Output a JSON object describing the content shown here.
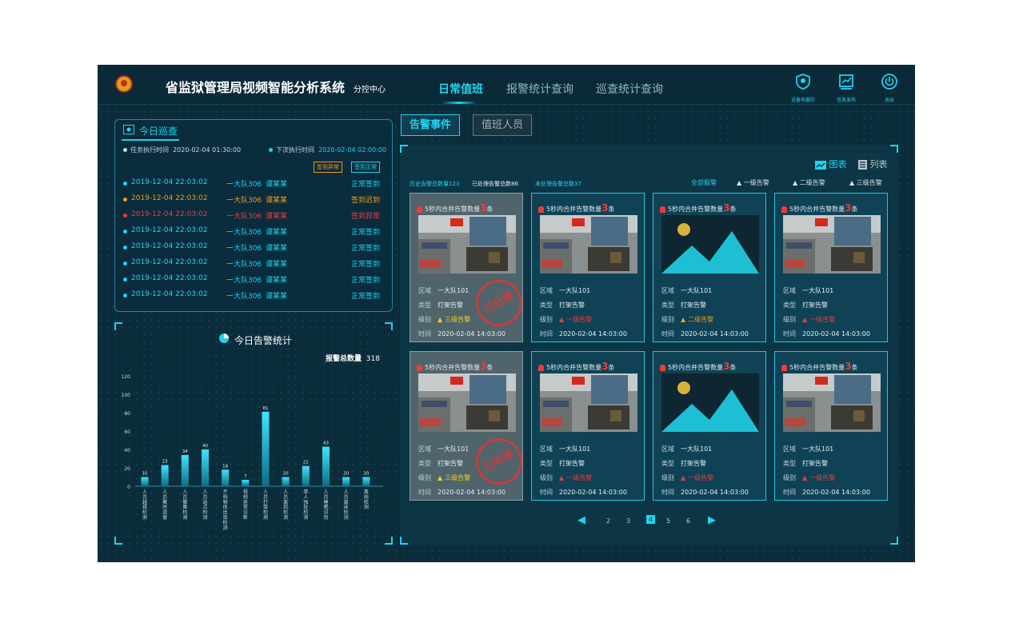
{
  "header": {
    "title": "省监狱管理局视频智能分析系统",
    "subtitle": "分控中心",
    "nav": [
      "日常值班",
      "报警统计查询",
      "巡查统计查询"
    ],
    "active_nav": "日常值班",
    "actions": [
      {
        "label": "设备布撤防",
        "icon": "shield-icon"
      },
      {
        "label": "信息发布",
        "icon": "publish-icon"
      },
      {
        "label": "退出",
        "icon": "power-icon"
      }
    ]
  },
  "patrol": {
    "title": "今日巡查",
    "task_time_label": "任务执行时间",
    "task_time": "2020-02-04 01:30:00",
    "next_time_label": "下次执行时间",
    "next_time": "2020-02-04 02:00:00",
    "btn_abnormal": "签到异常",
    "btn_normal": "签到正常",
    "rows": [
      {
        "time": "2019-12-04 22:03:02",
        "team": "一大队306",
        "name": "谭某某",
        "status": "正常签到",
        "color": "#1ed6f2"
      },
      {
        "time": "2019-12-04 22:03:02",
        "team": "一大队306",
        "name": "谭某某",
        "status": "签到迟到",
        "color": "#f29b1d"
      },
      {
        "time": "2019-12-04 22:03:02",
        "team": "一大队306",
        "name": "谭某某",
        "status": "签到异常",
        "color": "#f03b3b"
      },
      {
        "time": "2019-12-04 22:03:02",
        "team": "一大队306",
        "name": "谭某某",
        "status": "正常签到",
        "color": "#1ed6f2"
      },
      {
        "time": "2019-12-04 22:03:02",
        "team": "一大队306",
        "name": "谭某某",
        "status": "正常签到",
        "color": "#1ed6f2"
      },
      {
        "time": "2019-12-04 22:03:02",
        "team": "一大队306",
        "name": "谭某某",
        "status": "正常签到",
        "color": "#1ed6f2"
      },
      {
        "time": "2019-12-04 22:03:02",
        "team": "一大队306",
        "name": "谭某某",
        "status": "正常签到",
        "color": "#1ed6f2"
      },
      {
        "time": "2019-12-04 22:03:02",
        "team": "一大队306",
        "name": "谭某某",
        "status": "正常签到",
        "color": "#1ed6f2"
      }
    ]
  },
  "alarm_stats": {
    "title": "今日告警统计",
    "total_label": "报警总数量",
    "total": "318"
  },
  "chart_data": {
    "type": "bar",
    "title": "今日告警统计",
    "ylim": [
      0,
      120
    ],
    "yticks": [
      0,
      20,
      40,
      60,
      80,
      100,
      120
    ],
    "categories": [
      "人员越线检测",
      "人员聚时逗留",
      "人员聚集检测",
      "人员返点检测",
      "不明物体出现检测",
      "视频异常诊断",
      "人员打架检测",
      "人员离岗检测",
      "单人独处检测",
      "人员睡眠识别",
      "人员离床检测",
      "离岗检测"
    ],
    "values": [
      10,
      23,
      34,
      40,
      18,
      7,
      81,
      10,
      22,
      43,
      10,
      10
    ],
    "data_labels": [
      "10",
      "23",
      "34",
      "40",
      "18",
      "7",
      "81",
      "20",
      "22",
      "43",
      "20",
      "20"
    ]
  },
  "events": {
    "tab_active": "告警事件",
    "tab_inactive": "值班人员",
    "view_chart": "图表",
    "view_list": "列表",
    "history_label": "历史告警总数量",
    "history_count": "123",
    "processed_label": "已处理告警总数",
    "processed_count": "86",
    "unprocessed_label": "未处理告警总数",
    "unprocessed_count": "37",
    "filters": [
      "全部报警",
      "一级告警",
      "二级告警",
      "三级告警"
    ],
    "merge_prefix": "5秒内合并告警数量",
    "merge_suffix": "条",
    "field_labels": {
      "area": "区域",
      "type": "类型",
      "level": "级别",
      "time": "时间"
    },
    "stamp_text": "已处理",
    "cards": [
      {
        "count": "3",
        "area": "一大队101",
        "type": "打架告警",
        "level": "三级告警",
        "level_color": "#f3d21c",
        "time": "2020-02-04 14:03:00",
        "image": "room",
        "processed": true
      },
      {
        "count": "3",
        "area": "一大队101",
        "type": "打架告警",
        "level": "一级告警",
        "level_color": "#f03b3b",
        "time": "2020-02-04 14:03:00",
        "image": "room",
        "processed": false
      },
      {
        "count": "3",
        "area": "一大队101",
        "type": "打架告警",
        "level": "二级告警",
        "level_color": "#f29b1d",
        "time": "2020-02-04 14:03:00",
        "image": "placeholder",
        "processed": false
      },
      {
        "count": "3",
        "area": "一大队101",
        "type": "打架告警",
        "level": "一级告警",
        "level_color": "#f03b3b",
        "time": "2020-02-04 14:03:00",
        "image": "room",
        "processed": false
      },
      {
        "count": "3",
        "area": "一大队101",
        "type": "打架告警",
        "level": "三级告警",
        "level_color": "#f3d21c",
        "time": "2020-02-04 14:03:00",
        "image": "room",
        "processed": true
      },
      {
        "count": "3",
        "area": "一大队101",
        "type": "打架告警",
        "level": "一级告警",
        "level_color": "#f03b3b",
        "time": "2020-02-04 14:03:00",
        "image": "room",
        "processed": false
      },
      {
        "count": "3",
        "area": "一大队101",
        "type": "打架告警",
        "level": "一级告警",
        "level_color": "#f03b3b",
        "time": "2020-02-04 14:03:00",
        "image": "placeholder",
        "processed": false
      },
      {
        "count": "3",
        "area": "一大队101",
        "type": "打架告警",
        "level": "一级告警",
        "level_color": "#f03b3b",
        "time": "2020-02-04 14:03:00",
        "image": "room",
        "processed": false
      }
    ],
    "pages": [
      "2",
      "3",
      "4",
      "5",
      "6"
    ],
    "current_page": "4"
  },
  "colors": {
    "accent": "#20d3f0",
    "background": "#0b2d3b",
    "alarm_red": "#f03b3b",
    "warn_orange": "#f29b1d",
    "warn_yellow": "#f3d21c"
  }
}
